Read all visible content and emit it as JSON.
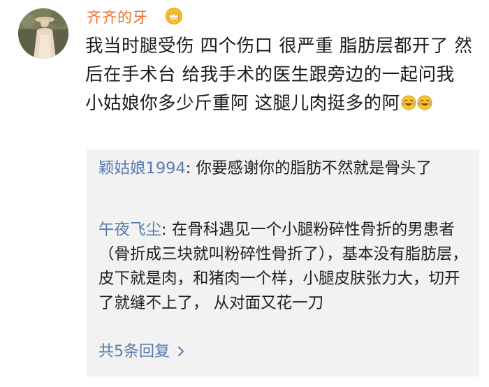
{
  "comment": {
    "username": "齐齐的牙",
    "user_badge_icon": "crown-icon",
    "avatar_icon": "avatar",
    "text": "我当时腿受伤 四个伤口 很严重 脂肪层都开了 然后在手术台 给我手术的医生跟旁边的一起问我 小姑娘你多少斤重阿 这腿儿肉挺多的阿",
    "emoji_icons": [
      "laughing-crying-emoji-icon",
      "laughing-crying-emoji-icon"
    ]
  },
  "replies": [
    {
      "author": "颖姑娘1994",
      "separator": ": ",
      "text": "你要感谢你的脂肪不然就是骨头了"
    },
    {
      "author": "午夜飞尘",
      "separator": ": ",
      "text": "在骨科遇见一个小腿粉碎性骨折的男患者（骨折成三块就叫粉碎性骨折了），基本没有脂肪层，皮下就是肉，和猪肉一个样，小腿皮肤张力大，切开了就缝不上了， 从对面又花一刀"
    }
  ],
  "more_replies": {
    "label": "共5条回复"
  },
  "colors": {
    "username": "#e8722d",
    "reply_author": "#5a7bb0",
    "reply_background": "#f2f2f2",
    "text": "#1a1a1a"
  }
}
